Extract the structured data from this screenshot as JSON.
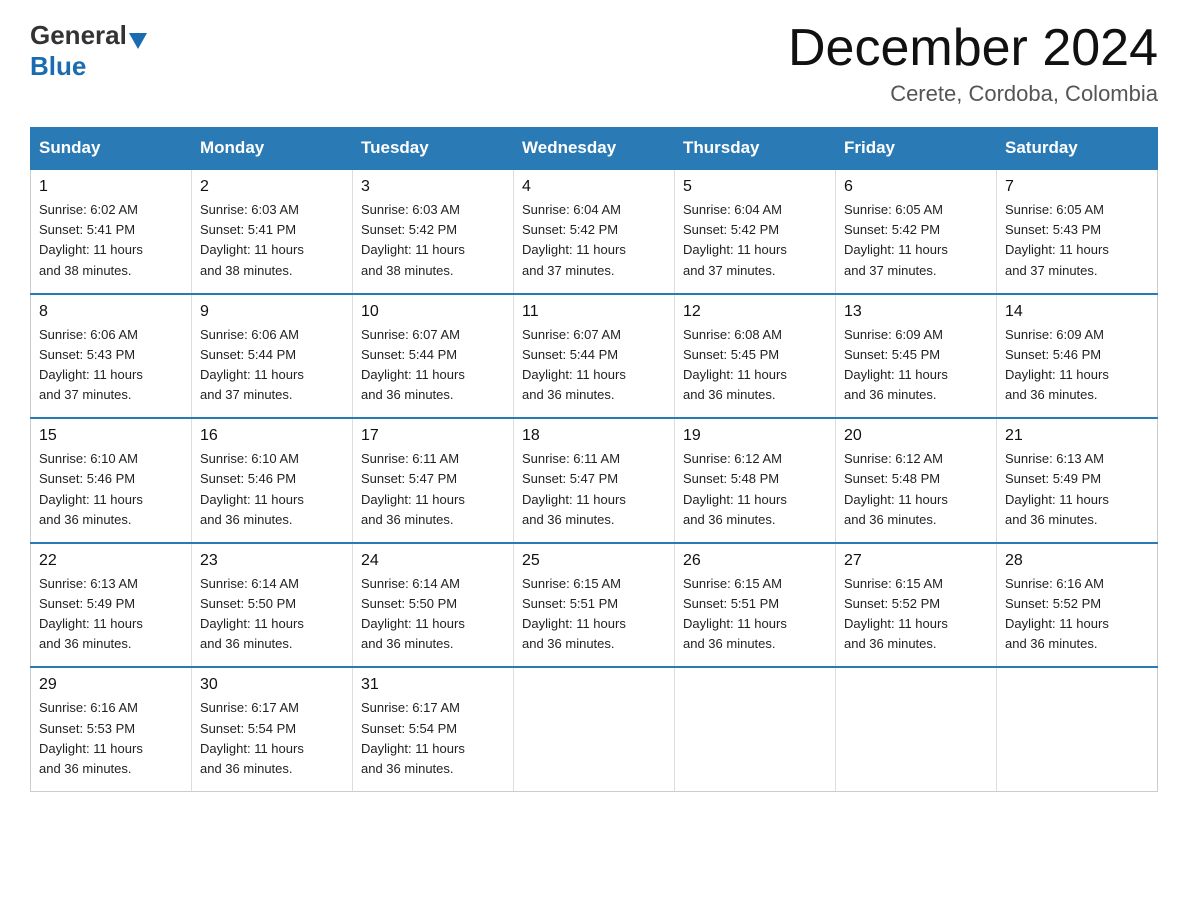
{
  "logo": {
    "general": "General",
    "blue": "Blue"
  },
  "title": "December 2024",
  "location": "Cerete, Cordoba, Colombia",
  "days_of_week": [
    "Sunday",
    "Monday",
    "Tuesday",
    "Wednesday",
    "Thursday",
    "Friday",
    "Saturday"
  ],
  "weeks": [
    [
      {
        "day": "1",
        "sunrise": "6:02 AM",
        "sunset": "5:41 PM",
        "daylight": "11 hours and 38 minutes."
      },
      {
        "day": "2",
        "sunrise": "6:03 AM",
        "sunset": "5:41 PM",
        "daylight": "11 hours and 38 minutes."
      },
      {
        "day": "3",
        "sunrise": "6:03 AM",
        "sunset": "5:42 PM",
        "daylight": "11 hours and 38 minutes."
      },
      {
        "day": "4",
        "sunrise": "6:04 AM",
        "sunset": "5:42 PM",
        "daylight": "11 hours and 37 minutes."
      },
      {
        "day": "5",
        "sunrise": "6:04 AM",
        "sunset": "5:42 PM",
        "daylight": "11 hours and 37 minutes."
      },
      {
        "day": "6",
        "sunrise": "6:05 AM",
        "sunset": "5:42 PM",
        "daylight": "11 hours and 37 minutes."
      },
      {
        "day": "7",
        "sunrise": "6:05 AM",
        "sunset": "5:43 PM",
        "daylight": "11 hours and 37 minutes."
      }
    ],
    [
      {
        "day": "8",
        "sunrise": "6:06 AM",
        "sunset": "5:43 PM",
        "daylight": "11 hours and 37 minutes."
      },
      {
        "day": "9",
        "sunrise": "6:06 AM",
        "sunset": "5:44 PM",
        "daylight": "11 hours and 37 minutes."
      },
      {
        "day": "10",
        "sunrise": "6:07 AM",
        "sunset": "5:44 PM",
        "daylight": "11 hours and 36 minutes."
      },
      {
        "day": "11",
        "sunrise": "6:07 AM",
        "sunset": "5:44 PM",
        "daylight": "11 hours and 36 minutes."
      },
      {
        "day": "12",
        "sunrise": "6:08 AM",
        "sunset": "5:45 PM",
        "daylight": "11 hours and 36 minutes."
      },
      {
        "day": "13",
        "sunrise": "6:09 AM",
        "sunset": "5:45 PM",
        "daylight": "11 hours and 36 minutes."
      },
      {
        "day": "14",
        "sunrise": "6:09 AM",
        "sunset": "5:46 PM",
        "daylight": "11 hours and 36 minutes."
      }
    ],
    [
      {
        "day": "15",
        "sunrise": "6:10 AM",
        "sunset": "5:46 PM",
        "daylight": "11 hours and 36 minutes."
      },
      {
        "day": "16",
        "sunrise": "6:10 AM",
        "sunset": "5:46 PM",
        "daylight": "11 hours and 36 minutes."
      },
      {
        "day": "17",
        "sunrise": "6:11 AM",
        "sunset": "5:47 PM",
        "daylight": "11 hours and 36 minutes."
      },
      {
        "day": "18",
        "sunrise": "6:11 AM",
        "sunset": "5:47 PM",
        "daylight": "11 hours and 36 minutes."
      },
      {
        "day": "19",
        "sunrise": "6:12 AM",
        "sunset": "5:48 PM",
        "daylight": "11 hours and 36 minutes."
      },
      {
        "day": "20",
        "sunrise": "6:12 AM",
        "sunset": "5:48 PM",
        "daylight": "11 hours and 36 minutes."
      },
      {
        "day": "21",
        "sunrise": "6:13 AM",
        "sunset": "5:49 PM",
        "daylight": "11 hours and 36 minutes."
      }
    ],
    [
      {
        "day": "22",
        "sunrise": "6:13 AM",
        "sunset": "5:49 PM",
        "daylight": "11 hours and 36 minutes."
      },
      {
        "day": "23",
        "sunrise": "6:14 AM",
        "sunset": "5:50 PM",
        "daylight": "11 hours and 36 minutes."
      },
      {
        "day": "24",
        "sunrise": "6:14 AM",
        "sunset": "5:50 PM",
        "daylight": "11 hours and 36 minutes."
      },
      {
        "day": "25",
        "sunrise": "6:15 AM",
        "sunset": "5:51 PM",
        "daylight": "11 hours and 36 minutes."
      },
      {
        "day": "26",
        "sunrise": "6:15 AM",
        "sunset": "5:51 PM",
        "daylight": "11 hours and 36 minutes."
      },
      {
        "day": "27",
        "sunrise": "6:15 AM",
        "sunset": "5:52 PM",
        "daylight": "11 hours and 36 minutes."
      },
      {
        "day": "28",
        "sunrise": "6:16 AM",
        "sunset": "5:52 PM",
        "daylight": "11 hours and 36 minutes."
      }
    ],
    [
      {
        "day": "29",
        "sunrise": "6:16 AM",
        "sunset": "5:53 PM",
        "daylight": "11 hours and 36 minutes."
      },
      {
        "day": "30",
        "sunrise": "6:17 AM",
        "sunset": "5:54 PM",
        "daylight": "11 hours and 36 minutes."
      },
      {
        "day": "31",
        "sunrise": "6:17 AM",
        "sunset": "5:54 PM",
        "daylight": "11 hours and 36 minutes."
      },
      null,
      null,
      null,
      null
    ]
  ],
  "labels": {
    "sunrise": "Sunrise:",
    "sunset": "Sunset:",
    "daylight": "Daylight:"
  }
}
